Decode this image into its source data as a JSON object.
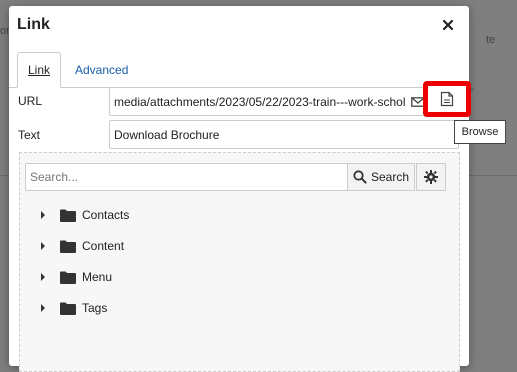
{
  "background": {
    "left_fragment": "or",
    "right_fragment": "te",
    "quote_fragment": "”"
  },
  "modal": {
    "title": "Link",
    "close_label": "×"
  },
  "tabs": [
    {
      "label": "Link",
      "active": true
    },
    {
      "label": "Advanced",
      "active": false
    }
  ],
  "url": {
    "label": "URL",
    "value": "media/attachments/2023/05/22/2023-train---work-schol"
  },
  "text": {
    "label": "Text",
    "value": "Download Brochure"
  },
  "browse": {
    "tooltip": "Browse"
  },
  "browser": {
    "search_placeholder": "Search...",
    "search_button": "Search",
    "tree": [
      {
        "label": "Contacts"
      },
      {
        "label": "Content"
      },
      {
        "label": "Menu"
      },
      {
        "label": "Tags"
      }
    ]
  },
  "colors": {
    "highlight": "#ee0000",
    "tab_link": "#1a5ea8"
  }
}
